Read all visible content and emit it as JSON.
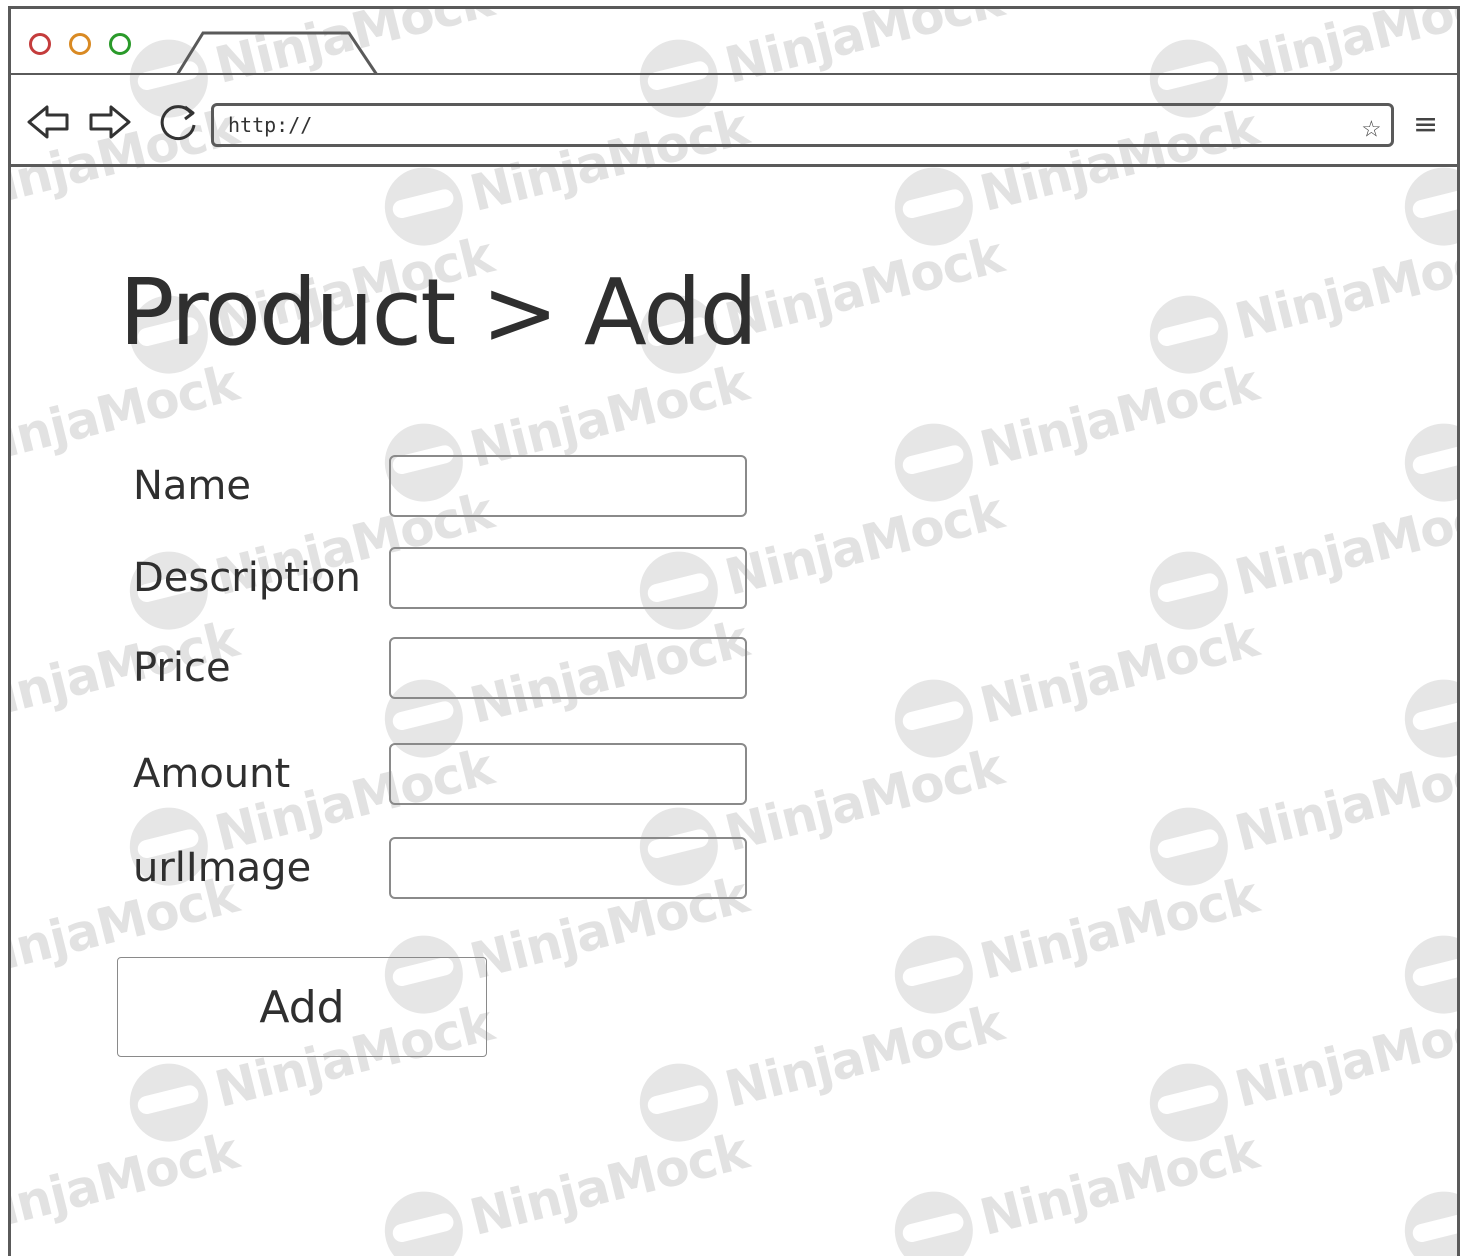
{
  "browser": {
    "url": "http://",
    "icons": [
      "back-arrow-icon",
      "forward-arrow-icon",
      "refresh-icon",
      "star-icon",
      "menu-icon"
    ]
  },
  "page": {
    "title": "Product > Add",
    "fields": [
      {
        "label": "Name",
        "value": ""
      },
      {
        "label": "Description",
        "value": ""
      },
      {
        "label": "Price",
        "value": ""
      },
      {
        "label": "Amount",
        "value": ""
      },
      {
        "label": "urlImage",
        "value": ""
      }
    ],
    "submit_label": "Add"
  },
  "watermark": {
    "text": "NinjaMock"
  },
  "colors": {
    "window_close": "#c43c3c",
    "window_minimize": "#d98a23",
    "window_maximize": "#2a9a2a",
    "frame": "#5a5a5a"
  }
}
